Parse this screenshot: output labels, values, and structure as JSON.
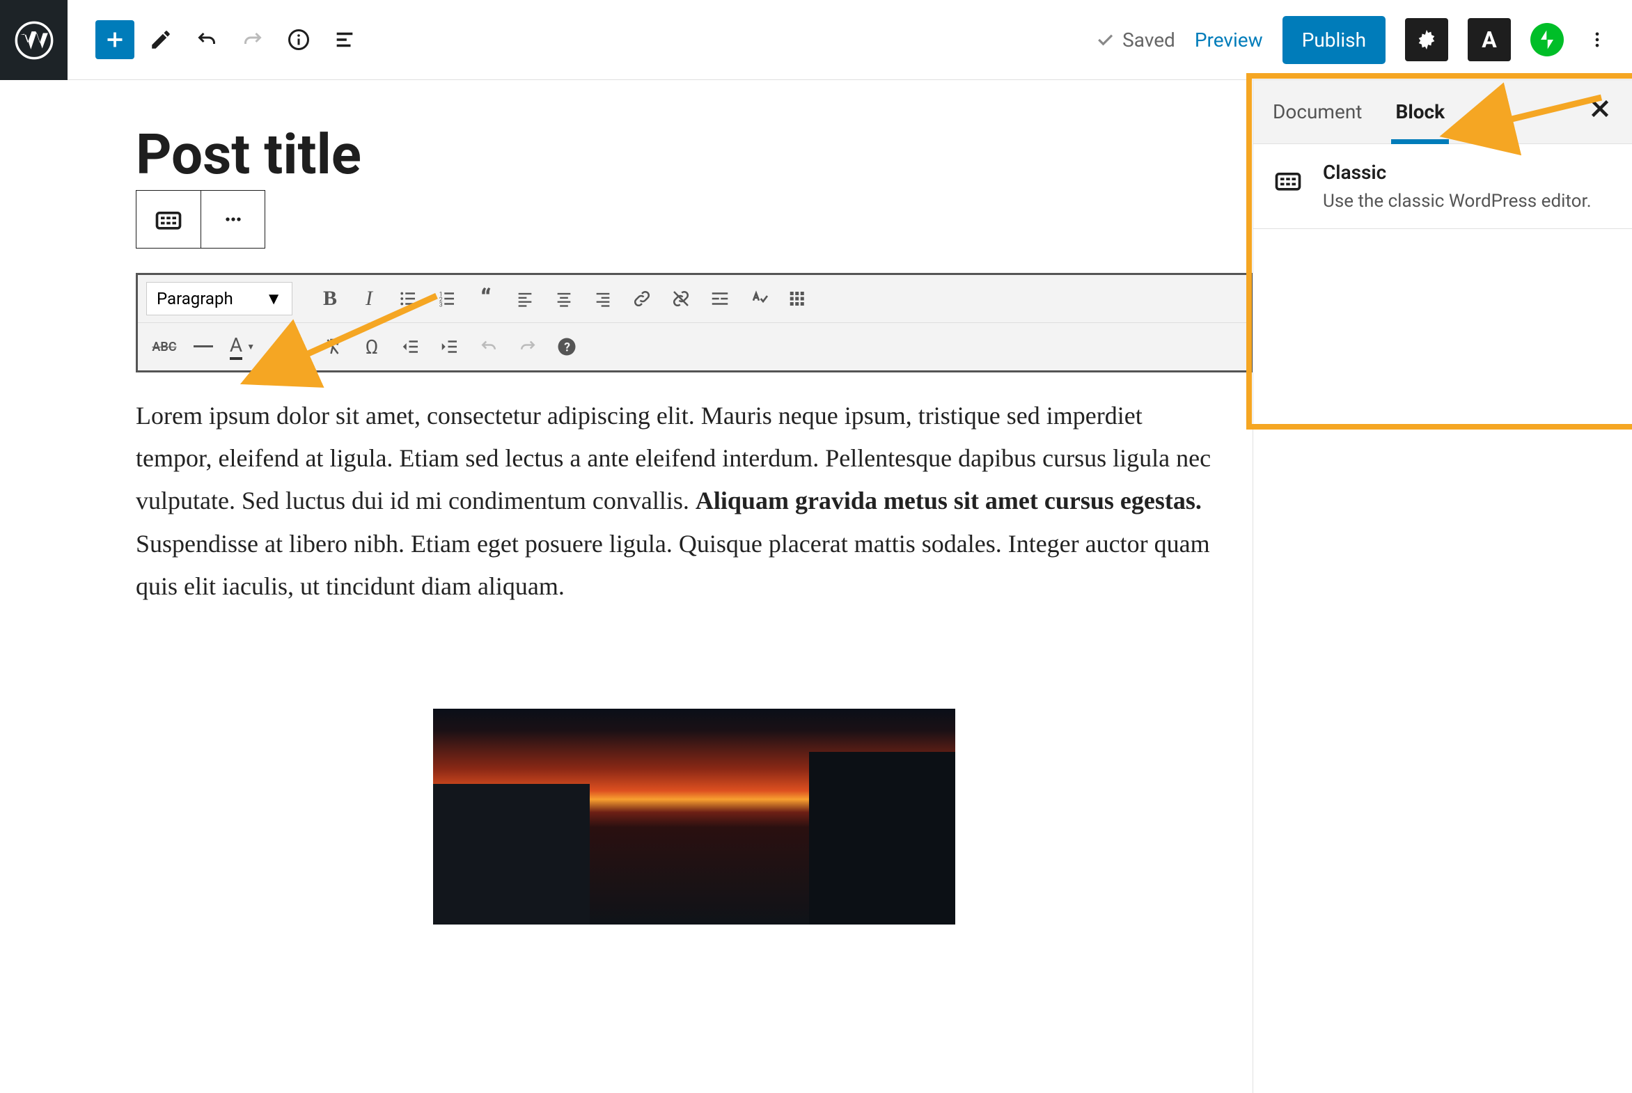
{
  "toolbar": {
    "saved_label": "Saved",
    "preview_label": "Preview",
    "publish_label": "Publish"
  },
  "editor": {
    "post_title": "Post title",
    "format_dropdown": "Paragraph",
    "paragraph_before_bold": "Lorem ipsum dolor sit amet, consectetur adipiscing elit. Mauris neque ipsum, tristique sed imperdiet tempor, eleifend at ligula. Etiam sed lectus a ante eleifend interdum. Pellentesque dapibus cursus ligula nec vulputate. Sed luctus dui id mi condimentum convallis. ",
    "paragraph_bold": "Aliquam gravida metus sit amet cursus egestas.",
    "paragraph_after_bold": " Suspendisse at libero nibh. Etiam eget posuere ligula. Quisque placerat mattis sodales. Integer auctor quam quis elit iaculis, ut tincidunt diam aliquam."
  },
  "classic_toolbar_row2": {
    "abc": "ABC",
    "underline_a": "A",
    "omega": "Ω"
  },
  "sidebar": {
    "tab_document": "Document",
    "tab_block": "Block",
    "block_title": "Classic",
    "block_desc": "Use the classic WordPress editor."
  }
}
